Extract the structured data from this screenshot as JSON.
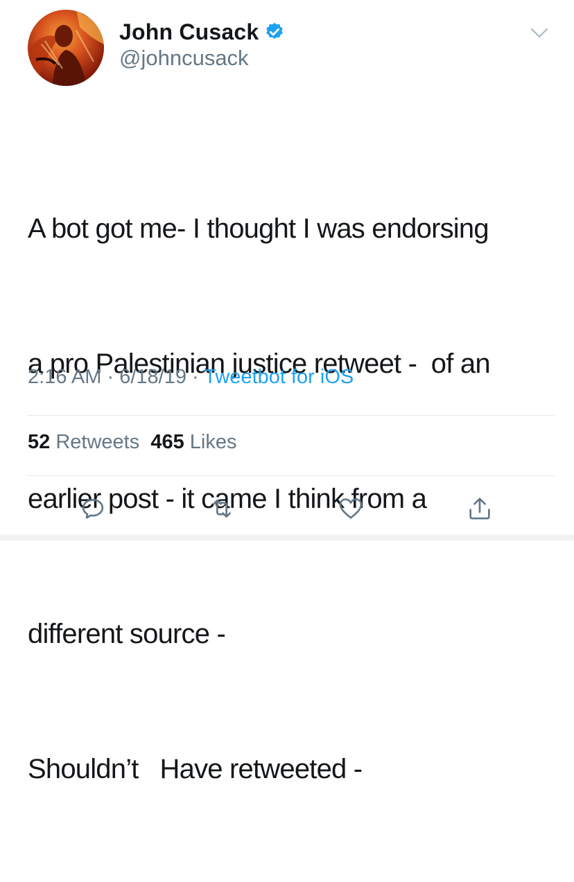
{
  "user": {
    "display_name": "John Cusack",
    "handle": "@johncusack",
    "verified": true,
    "avatar_icon": "profile-photo"
  },
  "tweet": {
    "lines": [
      "A bot got me- I thought I was endorsing",
      "a pro Palestinian justice retweet -  of an",
      "earlier post - it came I think from a",
      "different source -",
      "Shouldn’t   Have retweeted -"
    ],
    "time": "2:16 AM",
    "date": "6/18/19",
    "separator": "·",
    "source": "Tweetbot for iOS"
  },
  "stats": {
    "retweets_count": "52",
    "retweets_label": "Retweets",
    "likes_count": "465",
    "likes_label": "Likes"
  },
  "actions": {
    "reply_icon": "reply-icon",
    "retweet_icon": "retweet-icon",
    "like_icon": "heart-icon",
    "share_icon": "share-icon"
  },
  "colors": {
    "accent": "#1da1f2",
    "secondary_text": "#657786",
    "primary_text": "#14171a",
    "divider": "#e1e8ed"
  }
}
